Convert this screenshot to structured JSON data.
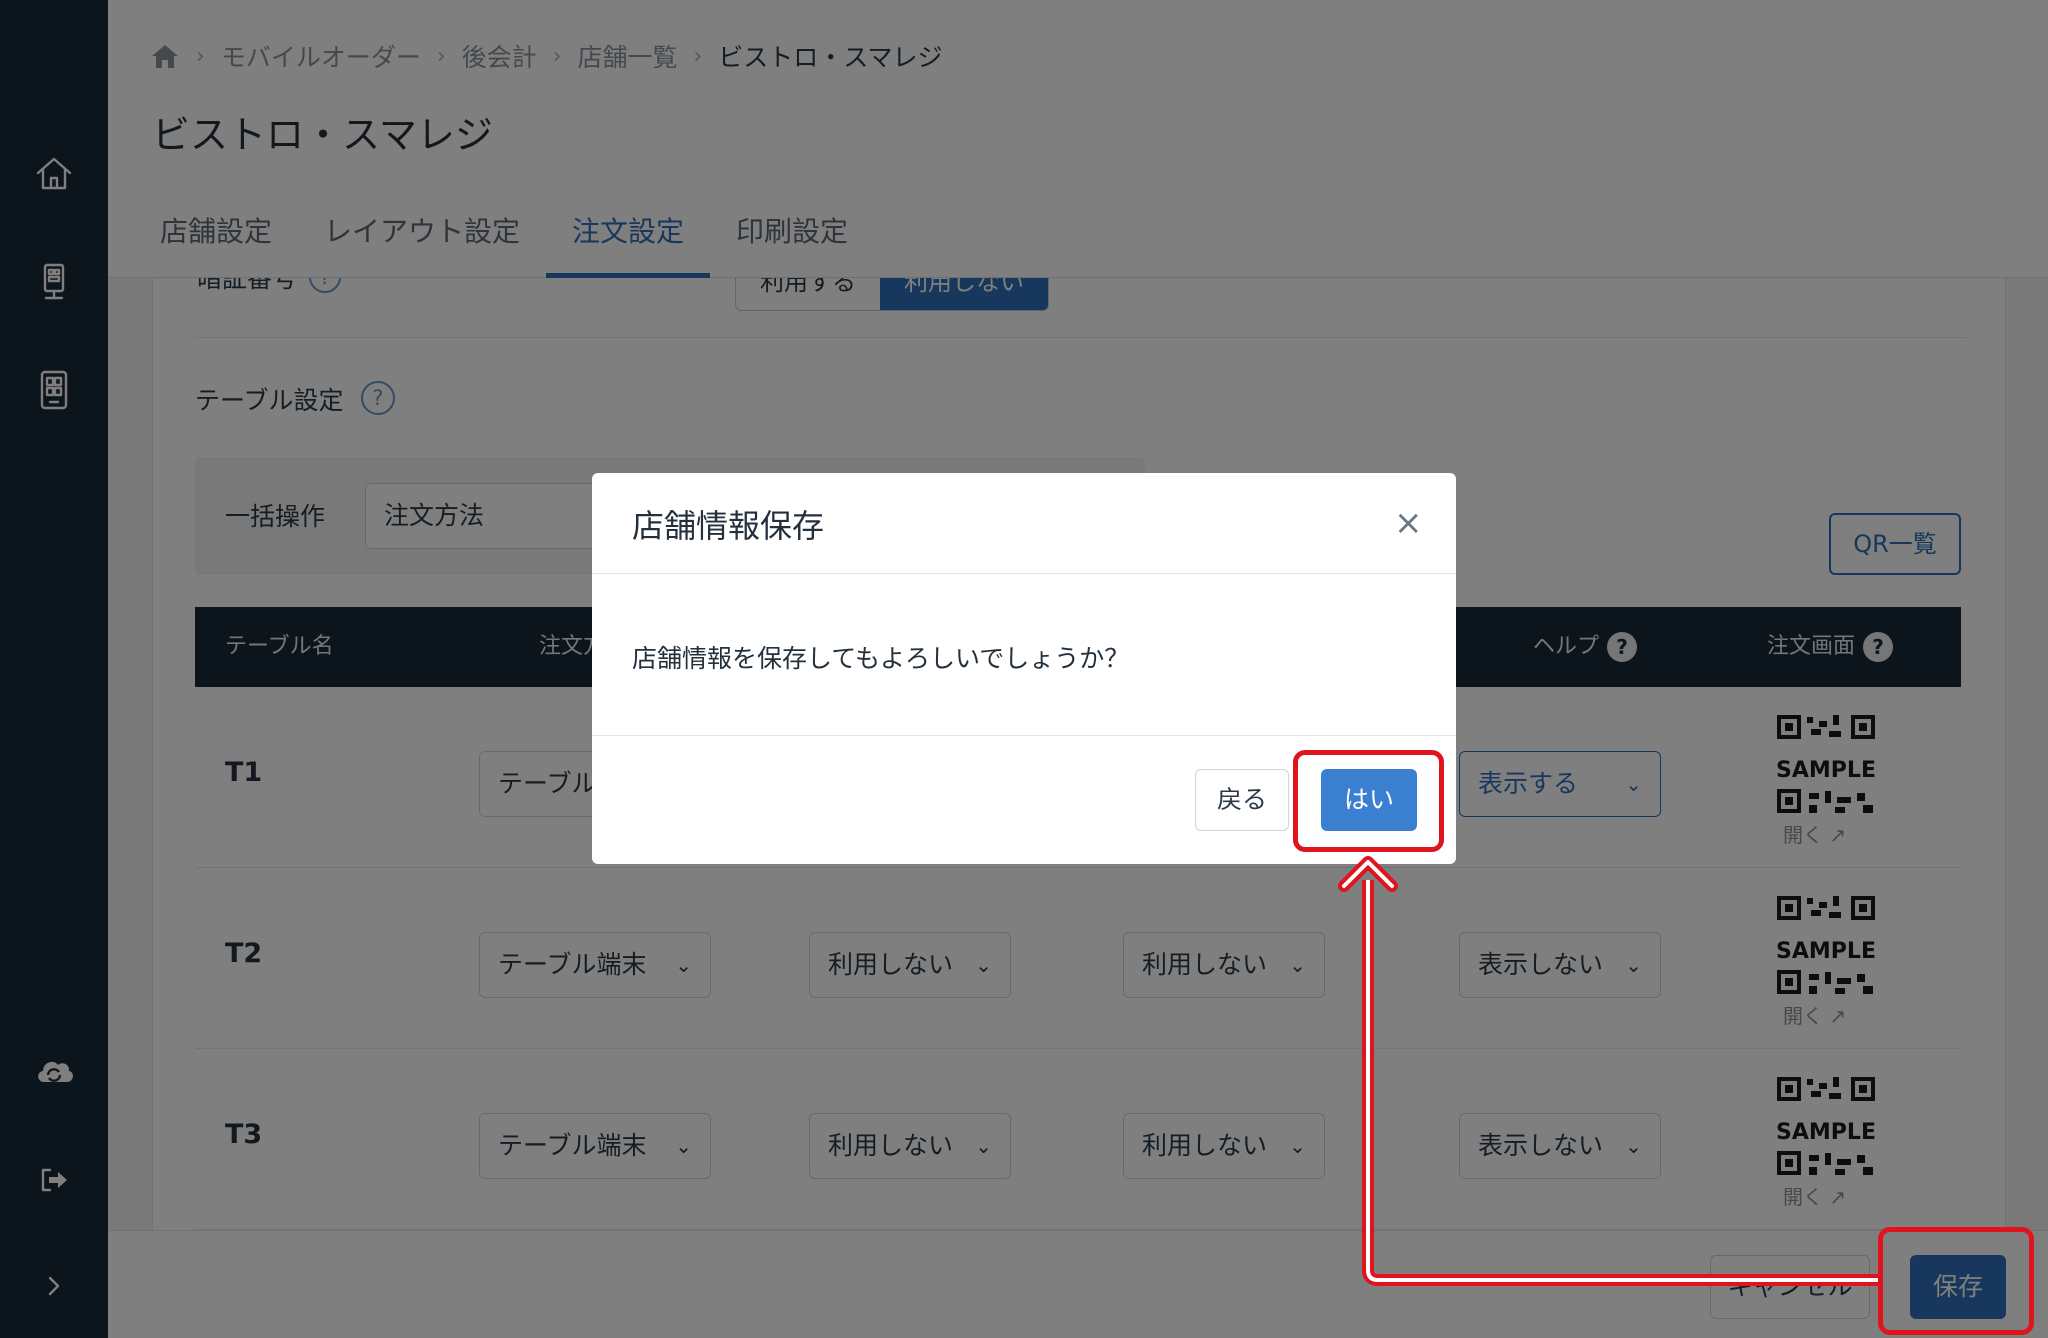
{
  "breadcrumb": {
    "home_icon": "home-icon",
    "items": [
      "モバイルオーダー",
      "後会計",
      "店舗一覧",
      "ビストロ・スマレジ"
    ]
  },
  "page_title": "ビストロ・スマレジ",
  "tabs": [
    {
      "label": "店舗設定",
      "active": false
    },
    {
      "label": "レイアウト設定",
      "active": false
    },
    {
      "label": "注文設定",
      "active": true
    },
    {
      "label": "印刷設定",
      "active": false
    }
  ],
  "pin": {
    "label": "暗証番号",
    "help": "?",
    "options": [
      "利用する",
      "利用しない"
    ],
    "selected": "利用しない"
  },
  "table_settings": {
    "label": "テーブル設定",
    "help": "?",
    "bulk_label": "一括操作",
    "bulk_value": "注文方法",
    "qr_list_label": "QR一覧"
  },
  "table": {
    "headers": {
      "name": "テーブル名",
      "order_method": "注文方",
      "help": "ヘルプ",
      "order_screen": "注文画面",
      "help_mark": "?"
    },
    "rows": [
      {
        "name": "T1",
        "order_method": "テーブル",
        "col3": "",
        "col4": "",
        "help": "表示する",
        "qr_text": "SAMPLE",
        "open": "開く"
      },
      {
        "name": "T2",
        "order_method": "テーブル端末",
        "col3": "利用しない",
        "col4": "利用しない",
        "help": "表示しない",
        "qr_text": "SAMPLE",
        "open": "開く"
      },
      {
        "name": "T3",
        "order_method": "テーブル端末",
        "col3": "利用しない",
        "col4": "利用しない",
        "help": "表示しない",
        "qr_text": "SAMPLE",
        "open": "開く"
      }
    ]
  },
  "footer": {
    "cancel_label": "キャンセル",
    "save_label": "保存"
  },
  "modal": {
    "title": "店舗情報保存",
    "close": "×",
    "message": "店舗情報を保存してもよろしいでしょうか？",
    "back_label": "戻る",
    "yes_label": "はい"
  },
  "colors": {
    "sidebar": "#1b2a38",
    "accent": "#2f6fb8",
    "yes_button": "#3a7fd0",
    "annotation": "#e0141d"
  }
}
